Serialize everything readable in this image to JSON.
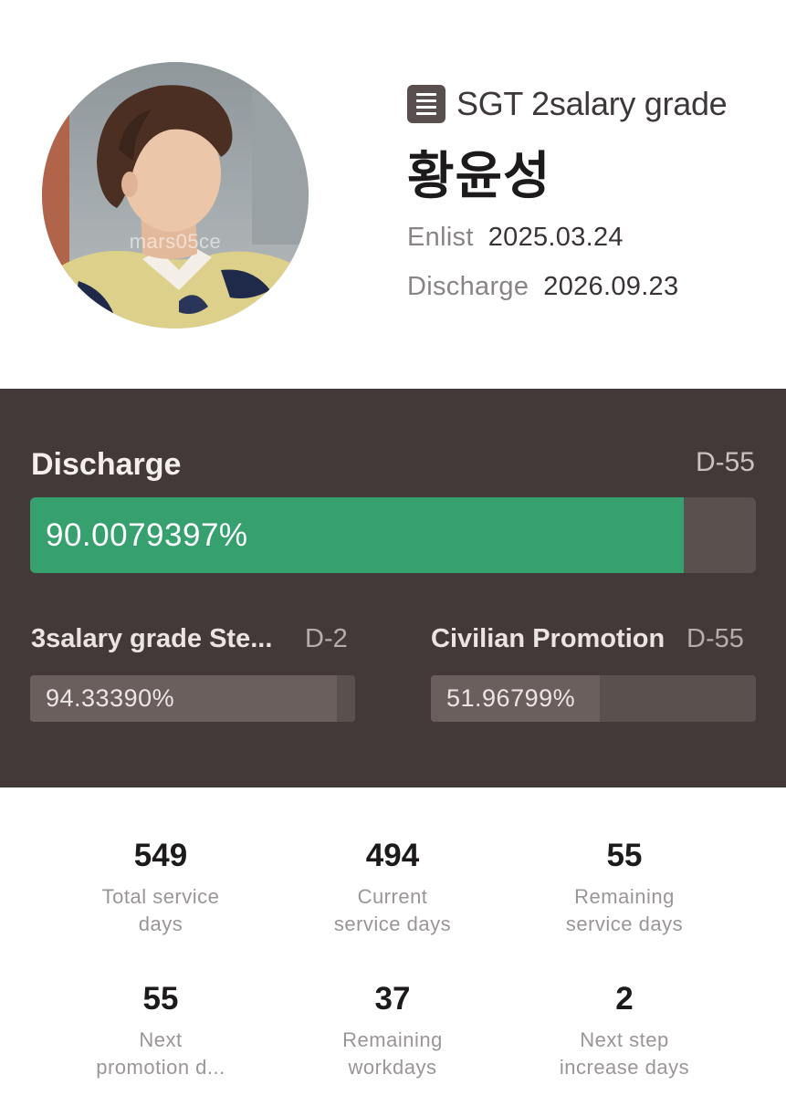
{
  "profile": {
    "avatar_watermark": "mars05ce",
    "rank_icon": "list-icon",
    "rank": "SGT 2salary grade",
    "name": "황윤성",
    "enlist_label": "Enlist",
    "enlist_date": "2025.03.24",
    "discharge_label": "Discharge",
    "discharge_date": "2026.09.23"
  },
  "progress": {
    "discharge": {
      "label": "Discharge",
      "dday": "D-55",
      "percent_text": "90.0079397%",
      "fraction": 0.900079397,
      "fill_color": "#36a06f"
    },
    "step": {
      "label": "3salary grade Ste...",
      "dday": "D-2",
      "percent_text": "94.33390%",
      "fraction": 0.943339
    },
    "civilian": {
      "label": "Civilian Promotion",
      "dday": "D-55",
      "percent_text": "51.96799%",
      "fraction": 0.5196799
    }
  },
  "stats": [
    {
      "value": "549",
      "line1": "Total service",
      "line2": "days"
    },
    {
      "value": "494",
      "line1": "Current",
      "line2": "service days"
    },
    {
      "value": "55",
      "line1": "Remaining",
      "line2": "service days"
    },
    {
      "value": "55",
      "line1": "Next",
      "line2": "promotion d..."
    },
    {
      "value": "37",
      "line1": "Remaining",
      "line2": "workdays"
    },
    {
      "value": "2",
      "line1": "Next step",
      "line2": "increase days"
    }
  ]
}
